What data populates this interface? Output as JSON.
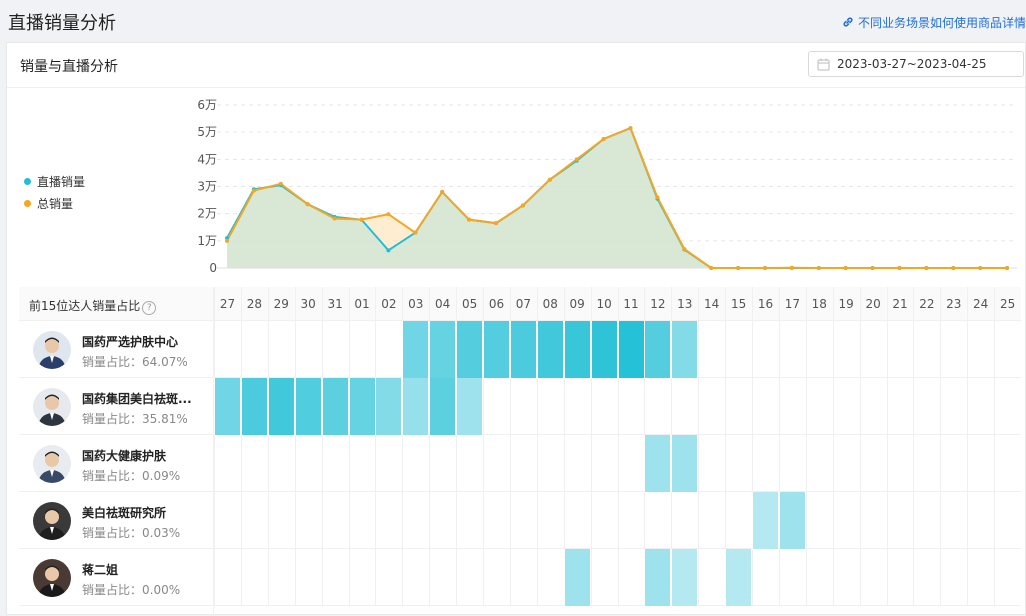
{
  "page": {
    "title": "直播销量分析",
    "help_link": "不同业务场景如何使用商品详情"
  },
  "card": {
    "title": "销量与直播分析",
    "date_range": "2023-03-27~2023-04-25"
  },
  "chart_data": {
    "type": "area",
    "x": [
      "2023-03-27",
      "2023-03-28",
      "2023-03-29",
      "2023-03-30",
      "2023-03-31",
      "2023-04-01",
      "2023-04-02",
      "2023-04-03",
      "2023-04-04",
      "2023-04-05",
      "2023-04-06",
      "2023-04-07",
      "2023-04-08",
      "2023-04-09",
      "2023-04-10",
      "2023-04-11",
      "2023-04-12",
      "2023-04-13",
      "2023-04-14",
      "2023-04-15",
      "2023-04-16",
      "2023-04-17",
      "2023-04-18",
      "2023-04-19",
      "2023-04-20",
      "2023-04-21",
      "2023-04-22",
      "2023-04-23",
      "2023-04-24",
      "2023-04-25"
    ],
    "yticks": [
      "6万",
      "5万",
      "4万",
      "3万",
      "2万",
      "1万",
      "0"
    ],
    "ylim": [
      0,
      60000
    ],
    "series": [
      {
        "name": "直播销量",
        "color": "#26bcd7",
        "values": [
          11000,
          29000,
          30500,
          23500,
          18800,
          17800,
          6500,
          13000,
          28000,
          17800,
          16500,
          23000,
          32500,
          39500,
          47500,
          51500,
          25500,
          6800,
          0,
          0,
          0,
          0,
          0,
          0,
          0,
          0,
          0,
          0,
          0,
          0
        ]
      },
      {
        "name": "总销量",
        "color": "#f5a623",
        "values": [
          10000,
          28500,
          31000,
          23500,
          18200,
          17800,
          19800,
          13000,
          28000,
          17800,
          16500,
          23000,
          32500,
          40000,
          47500,
          51500,
          26000,
          7000,
          0,
          0,
          0,
          100,
          0,
          0,
          0,
          0,
          0,
          0,
          0,
          0
        ]
      }
    ],
    "legend_position": "left",
    "grid": true
  },
  "heatmap": {
    "header_label": "前15位达人销量占比",
    "help_icon": "?",
    "days": [
      "27",
      "28",
      "29",
      "30",
      "31",
      "01",
      "02",
      "03",
      "04",
      "05",
      "06",
      "07",
      "08",
      "09",
      "10",
      "11",
      "12",
      "13",
      "14",
      "15",
      "16",
      "17",
      "18",
      "19",
      "20",
      "21",
      "22",
      "23",
      "24",
      "25"
    ],
    "rows": [
      {
        "name": "国药严选护肤中心",
        "share": "销量占比：64.07%",
        "levels": [
          0,
          0,
          0,
          0,
          0,
          0,
          0,
          0.55,
          0.6,
          0.7,
          0.7,
          0.75,
          0.8,
          0.85,
          0.9,
          0.95,
          0.7,
          0.45,
          0,
          0,
          0,
          0,
          0,
          0,
          0,
          0,
          0,
          0,
          0,
          0
        ]
      },
      {
        "name": "国药集团美白祛斑...",
        "share": "销量占比：35.81%",
        "levels": [
          0.55,
          0.75,
          0.8,
          0.72,
          0.65,
          0.6,
          0.45,
          0.35,
          0.65,
          0.3,
          0,
          0,
          0,
          0,
          0,
          0,
          0,
          0,
          0,
          0,
          0,
          0,
          0,
          0,
          0,
          0,
          0,
          0,
          0,
          0
        ]
      },
      {
        "name": "国药大健康护肤",
        "share": "销量占比：0.09%",
        "levels": [
          0,
          0,
          0,
          0,
          0,
          0,
          0,
          0,
          0,
          0,
          0,
          0,
          0,
          0,
          0,
          0,
          0.3,
          0.3,
          0,
          0,
          0,
          0,
          0,
          0,
          0,
          0,
          0,
          0,
          0,
          0
        ]
      },
      {
        "name": "美白祛斑研究所",
        "share": "销量占比：0.03%",
        "levels": [
          0,
          0,
          0,
          0,
          0,
          0,
          0,
          0,
          0,
          0,
          0,
          0,
          0,
          0,
          0,
          0,
          0,
          0,
          0,
          0,
          0.18,
          0.3,
          0,
          0,
          0,
          0,
          0,
          0,
          0,
          0
        ]
      },
      {
        "name": "蒋二姐",
        "share": "销量占比：0.00%",
        "levels": [
          0,
          0,
          0,
          0,
          0,
          0,
          0,
          0,
          0,
          0,
          0,
          0,
          0,
          0.3,
          0,
          0,
          0.3,
          0.18,
          0,
          0.18,
          0,
          0,
          0,
          0,
          0,
          0,
          0,
          0,
          0,
          0
        ]
      }
    ]
  }
}
